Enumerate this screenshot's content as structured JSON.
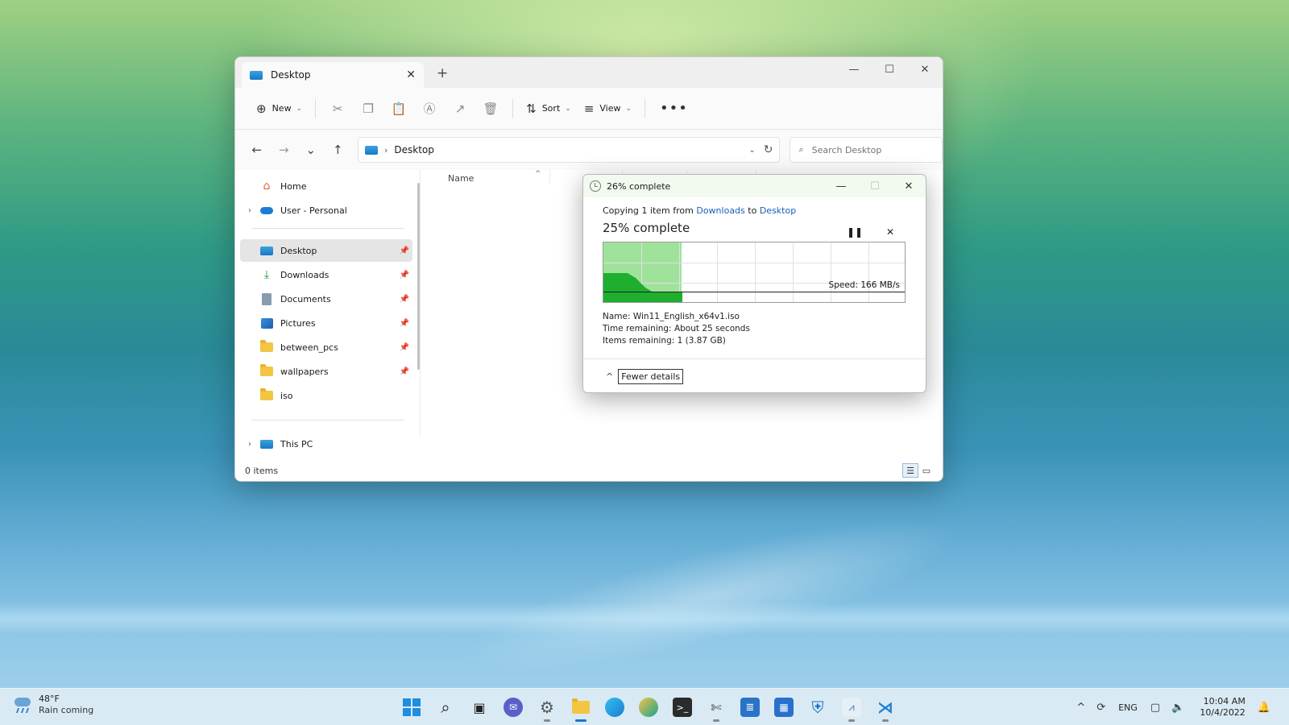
{
  "explorer": {
    "tab_title": "Desktop",
    "toolbar": {
      "new_label": "New",
      "sort_label": "Sort",
      "view_label": "View"
    },
    "address": {
      "crumb": "Desktop",
      "search_placeholder": "Search Desktop"
    },
    "nav": {
      "home": "Home",
      "onedrive": "User - Personal",
      "desktop": "Desktop",
      "downloads": "Downloads",
      "documents": "Documents",
      "pictures": "Pictures",
      "between_pcs": "between_pcs",
      "wallpapers": "wallpapers",
      "iso": "iso",
      "this_pc": "This PC"
    },
    "columns": {
      "name": "Name"
    },
    "status": {
      "items": "0 items"
    }
  },
  "copy_dialog": {
    "title": "26% complete",
    "line_prefix": "Copying 1 item from ",
    "source": "Downloads",
    "line_mid": " to ",
    "destination": "Desktop",
    "status": "25% complete",
    "progress_fraction": 0.26,
    "speed": "Speed: 166 MB/s",
    "name_label": "Name:",
    "name_value": "Win11_English_x64v1.iso",
    "time_label": "Time remaining:",
    "time_value": "About 25 seconds",
    "items_label": "Items remaining:",
    "items_value": "1 (3.87 GB)",
    "fewer_details": "Fewer details"
  },
  "taskbar": {
    "weather_temp": "48°F",
    "weather_cond": "Rain coming",
    "language": "ENG",
    "time": "10:04 AM",
    "date": "10/4/2022"
  },
  "colors": {
    "accent": "#1a73c8",
    "progress_fill": "#9fe39b",
    "graph_fill": "#1fae2e",
    "link": "#1a5fb4"
  }
}
